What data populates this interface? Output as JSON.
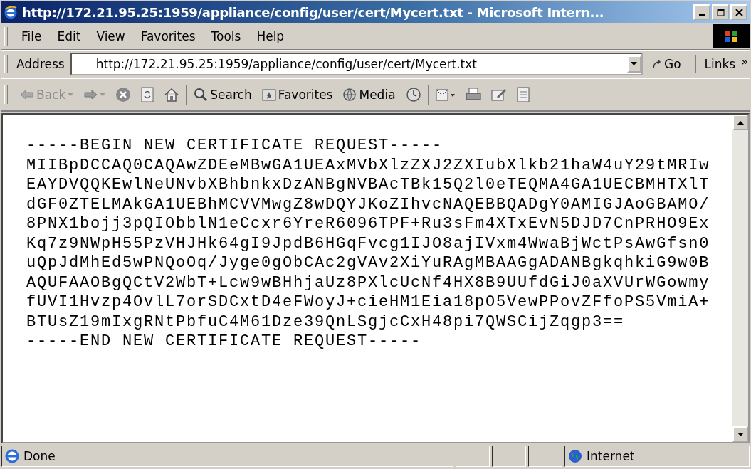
{
  "window": {
    "title": "http://172.21.95.25:1959/appliance/config/user/cert/Mycert.txt - Microsoft Intern..."
  },
  "menu": [
    "File",
    "Edit",
    "View",
    "Favorites",
    "Tools",
    "Help"
  ],
  "address_bar": {
    "label": "Address",
    "value": "http://172.21.95.25:1959/appliance/config/user/cert/Mycert.txt",
    "go": "Go",
    "links": "Links",
    "more": "»"
  },
  "toolbar": [
    {
      "kind": "back",
      "label": "Back"
    },
    {
      "kind": "forward"
    },
    {
      "kind": "stop"
    },
    {
      "kind": "refresh"
    },
    {
      "kind": "home"
    },
    {
      "kind": "sep"
    },
    {
      "kind": "search",
      "label": "Search"
    },
    {
      "kind": "favorites",
      "label": "Favorites"
    },
    {
      "kind": "media",
      "label": "Media"
    },
    {
      "kind": "history"
    },
    {
      "kind": "sep"
    },
    {
      "kind": "mail"
    },
    {
      "kind": "print"
    },
    {
      "kind": "edit"
    },
    {
      "kind": "discuss"
    }
  ],
  "document_lines": [
    "-----BEGIN NEW CERTIFICATE REQUEST-----",
    "MIIBpDCCAQ0CAQAwZDEeMBwGA1UEAxMVbXlzZXJ2ZXIubXlkb21haW4uY29tMRIw",
    "EAYDVQQKEwlNeUNvbXBhbnkxDzANBgNVBAcTBk15Q2l0eTEQMA4GA1UECBMHTXlT",
    "dGF0ZTELMAkGA1UEBhMCVVMwgZ8wDQYJKoZIhvcNAQEBBQADgY0AMIGJAoGBAMO/",
    "8PNX1bojj3pQIObblN1eCcxr6YreR6096TPF+Ru3sFm4XTxEvN5DJD7CnPRHO9Ex",
    "Kq7z9NWpH55PzVHJHk64gI9JpdB6HGqFvcg1IJO8ajIVxm4WwaBjWctPsAwGfsn0",
    "uQpJdMhEd5wPNQoOq/Jyge0gObCAc2gVAv2XiYuRAgMBAAGgADANBgkqhkiG9w0B",
    "AQUFAAOBgQCtV2WbT+Lcw9wBHhjaUz8PXlcUcNf4HX8B9UUfdGiJ0aXVUrWGowmy",
    "fUVI1Hvzp4OvlL7orSDCxtD4eFWoyJ+cieHM1Eia18pO5VewPPovZFfoPS5VmiA+",
    "BTUsZ19mIxgRNtPbfuC4M61Dze39QnLSgjcCxH48pi7QWSCijZqgp3==",
    "-----END NEW CERTIFICATE REQUEST-----"
  ],
  "status_bar": {
    "status": "Done",
    "zone": "Internet"
  }
}
